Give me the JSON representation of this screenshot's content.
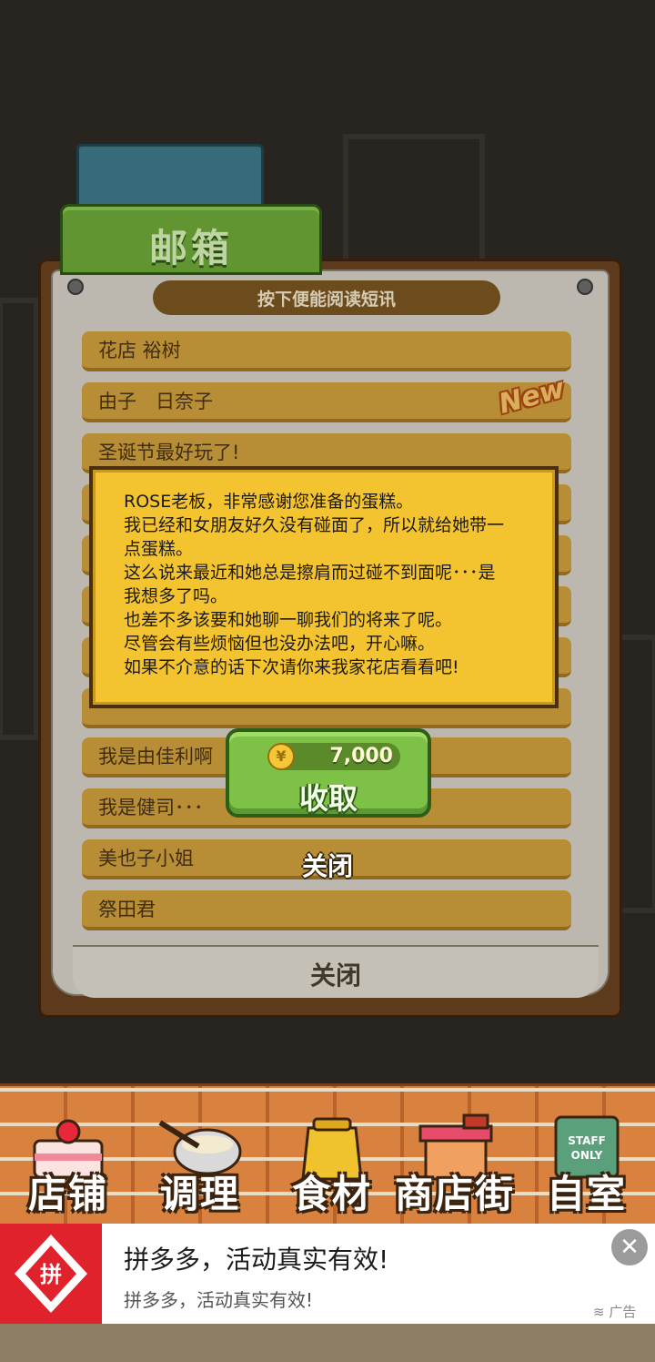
{
  "mailbox": {
    "title": "邮箱",
    "instruction": "按下便能阅读短讯",
    "new_badge": "New",
    "items": [
      {
        "sender": "花店 裕树"
      },
      {
        "sender": "由子　日奈子"
      },
      {
        "sender": "圣诞节最好玩了!"
      },
      {
        "sender": ""
      },
      {
        "sender": ""
      },
      {
        "sender": ""
      },
      {
        "sender": ""
      },
      {
        "sender": ""
      },
      {
        "sender": "我是由佳利啊"
      },
      {
        "sender": "我是健司･･･"
      },
      {
        "sender": "美也子小姐"
      },
      {
        "sender": "祭田君"
      }
    ],
    "close_label": "关闭"
  },
  "message": {
    "lines": [
      "ROSE老板，非常感谢您准备的蛋糕。",
      "我已经和女朋友好久没有碰面了，所以就给她带一",
      "点蛋糕。",
      "这么说来最近和她总是擦肩而过碰不到面呢･･･是",
      "我想多了吗。",
      "也差不多该要和她聊一聊我们的将来了呢。",
      "尽管会有些烦恼但也没办法吧，开心嘛。",
      "如果不介意的话下次请你来我家花店看看吧!"
    ],
    "reward_amount": "7,000",
    "reward_icon": "yen-coin-icon",
    "collect_label": "收取",
    "close_label": "关闭"
  },
  "nav": {
    "items": [
      {
        "label": "店铺",
        "icon": "cake-icon"
      },
      {
        "label": "调理",
        "icon": "mixing-bowl-icon"
      },
      {
        "label": "食材",
        "icon": "flour-sack-icon"
      },
      {
        "label": "商店街",
        "icon": "shop-icon"
      },
      {
        "label": "自室",
        "icon": "staff-only-door-icon"
      }
    ],
    "staff_sign": "STAFF ONLY"
  },
  "ad": {
    "logo_text": "拼",
    "title": "拼多多，活动真实有效!",
    "subtitle": "拼多多，活动真实有效!",
    "tag": "广告",
    "close_icon": "close-icon"
  },
  "colors": {
    "paper_item": "#d1a13d",
    "message_bg": "#f3c42f",
    "button_green": "#7dc247",
    "ad_red": "#e0222d"
  }
}
